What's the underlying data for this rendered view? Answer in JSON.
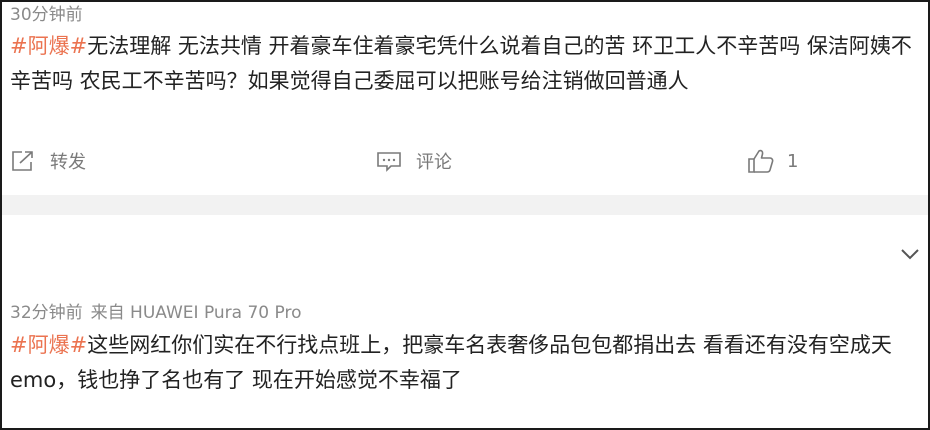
{
  "posts": [
    {
      "time": "30分钟前",
      "source": "",
      "hashtag": "#阿爆#",
      "text": "无法理解 无法共情 开着豪车住着豪宅凭什么说着自己的苦 环卫工人不辛苦吗 保洁阿姨不辛苦吗 农民工不辛苦吗？如果觉得自己委屈可以把账号给注销做回普通人",
      "actions": {
        "forward_label": "转发",
        "comment_label": "评论",
        "like_count": "1"
      }
    },
    {
      "time": "32分钟前",
      "source": "来自 HUAWEI Pura 70 Pro",
      "hashtag": "#阿爆#",
      "text": "这些网红你们实在不行找点班上，把豪车名表奢侈品包包都捐出去 看看还有没有空成天emo，钱也挣了名也有了 现在开始感觉不幸福了"
    }
  ],
  "colors": {
    "hashtag": "#eb7350",
    "meta": "#8a8a8a",
    "text": "#222222",
    "action": "#7a7a7a",
    "divider": "#f2f2f2"
  },
  "icons": {
    "forward": "share-forward-icon",
    "comment": "comment-icon",
    "like": "thumbs-up-icon",
    "collapse": "chevron-down-icon"
  }
}
